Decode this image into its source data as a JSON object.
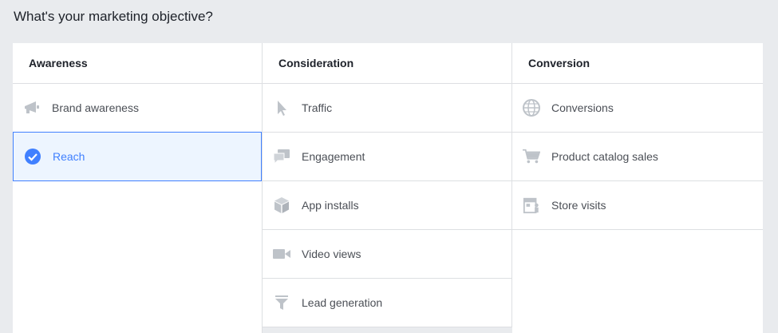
{
  "page": {
    "title": "What's your marketing objective?"
  },
  "colors": {
    "selected_accent": "#4080ff",
    "icon_gray": "#bec3c9"
  },
  "columns": [
    {
      "header": "Awareness",
      "items": [
        {
          "label": "Brand awareness",
          "icon": "megaphone-icon"
        },
        {
          "label": "Reach",
          "icon": "check-circle-icon",
          "selected": true
        }
      ]
    },
    {
      "header": "Consideration",
      "items": [
        {
          "label": "Traffic",
          "icon": "cursor-icon"
        },
        {
          "label": "Engagement",
          "icon": "chat-bubbles-icon"
        },
        {
          "label": "App installs",
          "icon": "box-icon"
        },
        {
          "label": "Video views",
          "icon": "video-camera-icon"
        },
        {
          "label": "Lead generation",
          "icon": "funnel-icon"
        }
      ]
    },
    {
      "header": "Conversion",
      "items": [
        {
          "label": "Conversions",
          "icon": "globe-icon"
        },
        {
          "label": "Product catalog sales",
          "icon": "shopping-cart-icon"
        },
        {
          "label": "Store visits",
          "icon": "store-icon"
        }
      ]
    }
  ]
}
